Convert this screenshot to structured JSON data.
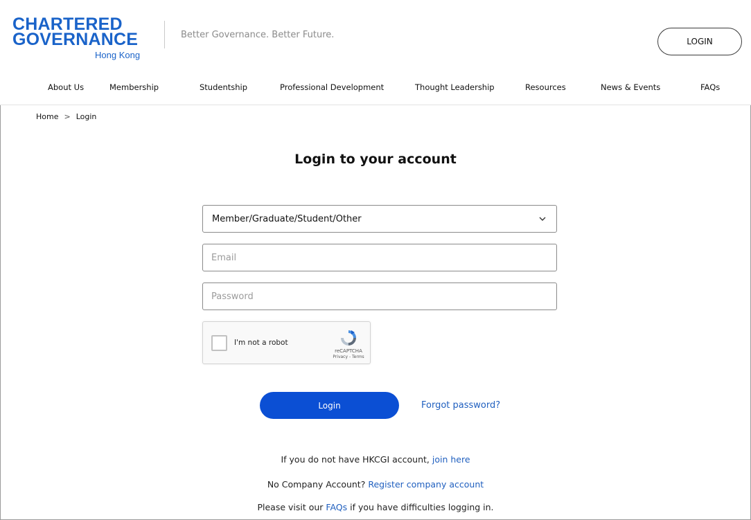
{
  "brand": {
    "logo_line1": "CHARTERED",
    "logo_line2": "GOVERNANCE",
    "logo_sub": "Hong Kong",
    "tagline": "Better Governance. Better Future.",
    "accent_color": "#1a63c9"
  },
  "header": {
    "login_label": "LOGIN"
  },
  "nav": {
    "items": [
      {
        "label": "About Us"
      },
      {
        "label": "Membership"
      },
      {
        "label": "Studentship"
      },
      {
        "label": "Professional Development"
      },
      {
        "label": "Thought Leadership"
      },
      {
        "label": "Resources"
      },
      {
        "label": "News & Events"
      },
      {
        "label": "FAQs"
      }
    ]
  },
  "breadcrumb": {
    "home": "Home",
    "separator": ">",
    "current": "Login"
  },
  "form": {
    "title": "Login to your account",
    "account_type": "Member/Graduate/Student/Other",
    "email_placeholder": "Email",
    "email_value": "",
    "password_placeholder": "Password",
    "password_value": "",
    "recaptcha": {
      "label": "I'm not a robot",
      "brand": "reCAPTCHA",
      "links": "Privacy - Terms"
    },
    "login_label": "Login",
    "forgot_label": "Forgot password?",
    "button_color": "#0b4fd4"
  },
  "info": {
    "join_prefix": "If you do not have HKCGI account, ",
    "join_link": "join here",
    "company_prefix": "No Company Account? ",
    "company_link": "Register company account",
    "faq_prefix": "Please visit our ",
    "faq_link": "FAQs",
    "faq_suffix": " if you have difficulties logging in."
  }
}
